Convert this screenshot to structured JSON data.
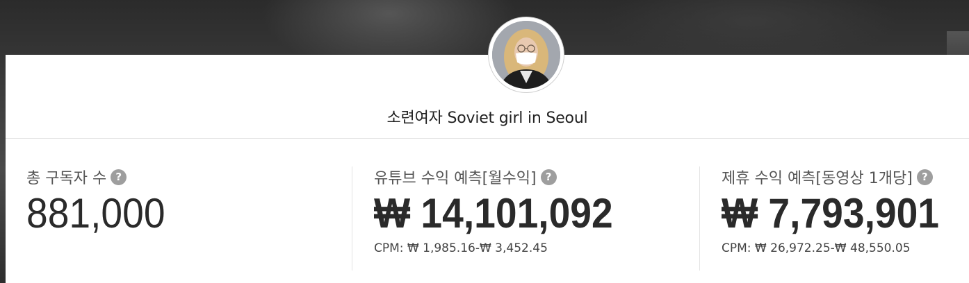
{
  "channel": {
    "name": "소련여자 Soviet girl in Seoul"
  },
  "stats": [
    {
      "label": "총 구독자 수",
      "value": "881,000"
    },
    {
      "label": "유튜브 수익 예측[월수익]",
      "value": "₩ 14,101,092",
      "cpm": "CPM: ₩ 1,985.16-₩ 3,452.45"
    },
    {
      "label": "제휴 수익 예측[동영상 1개당]",
      "value": "₩ 7,793,901",
      "cpm": "CPM: ₩ 26,972.25-₩ 48,550.05"
    }
  ],
  "help_icon_glyph": "?"
}
